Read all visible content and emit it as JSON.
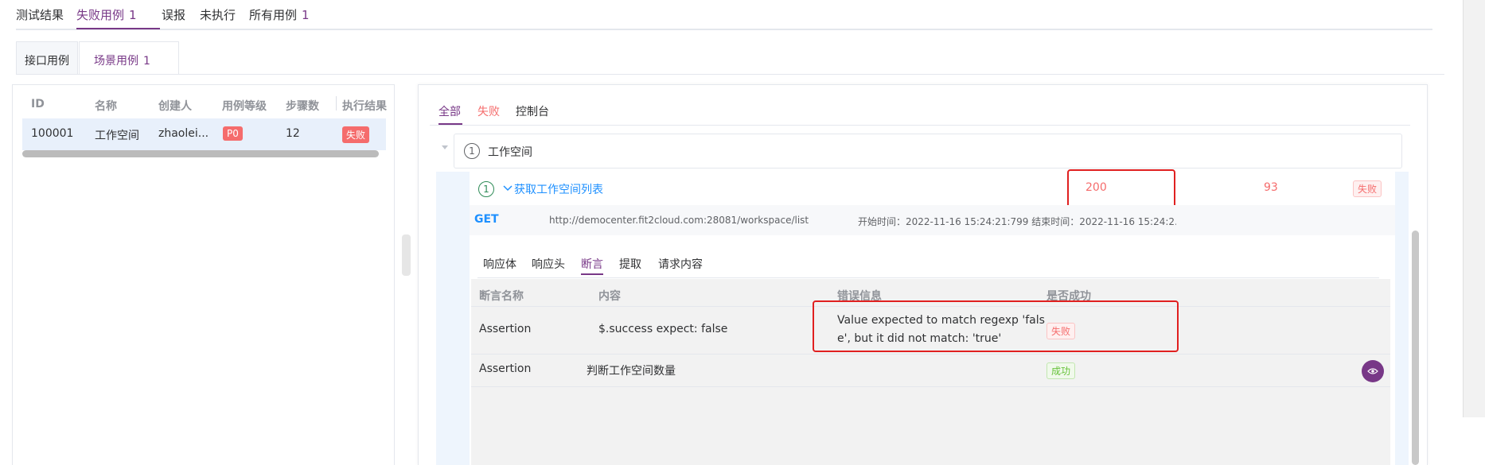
{
  "top_tabs": [
    {
      "label": "测试结果",
      "count": ""
    },
    {
      "label": "失败用例",
      "count": "1"
    },
    {
      "label": "误报",
      "count": ""
    },
    {
      "label": "未执行",
      "count": ""
    },
    {
      "label": "所有用例",
      "count": "1"
    }
  ],
  "sub_tabs": [
    {
      "label": "接口用例",
      "count": ""
    },
    {
      "label": "场景用例",
      "count": "1"
    }
  ],
  "case_table": {
    "headers": [
      "ID",
      "名称",
      "创建人",
      "用例等级",
      "步骤数",
      "执行结果"
    ],
    "rows": [
      {
        "id": "100001",
        "name": "工作空间",
        "creator": "zhaolei...",
        "level": "P0",
        "steps": "12",
        "result": "失败"
      }
    ]
  },
  "result_tabs": [
    "全部",
    "失败",
    "控制台"
  ],
  "scenario": {
    "index": "1",
    "name": "工作空间"
  },
  "step": {
    "index": "1",
    "title": "获取工作空间列表",
    "status_code": "200",
    "time": "93",
    "result": "失败",
    "method": "GET",
    "url": "http://democenter.fit2cloud.com:28081/workspace/list",
    "timing": "开始时间：2022-11-16 15:24:21:799 结束时间：2022-11-16 15:24:2..."
  },
  "inner_tabs": [
    "响应体",
    "响应头",
    "断言",
    "提取",
    "请求内容"
  ],
  "assertions": {
    "headers": [
      "断言名称",
      "内容",
      "错误信息",
      "是否成功"
    ],
    "rows": [
      {
        "name": "Assertion",
        "content": "$.success expect: false",
        "error_line1": "Value expected to match regexp 'fals",
        "error_line2": "e', but it did not match: 'true'",
        "result": "失败"
      },
      {
        "name": "Assertion",
        "content": "判断工作空间数量",
        "error_line1": "",
        "error_line2": "",
        "result": "成功"
      }
    ]
  },
  "colors": {
    "accent": "#783887",
    "danger": "#f56c6c",
    "success": "#67c23a",
    "highlight": "#e02020",
    "link": "#1e90ff"
  }
}
